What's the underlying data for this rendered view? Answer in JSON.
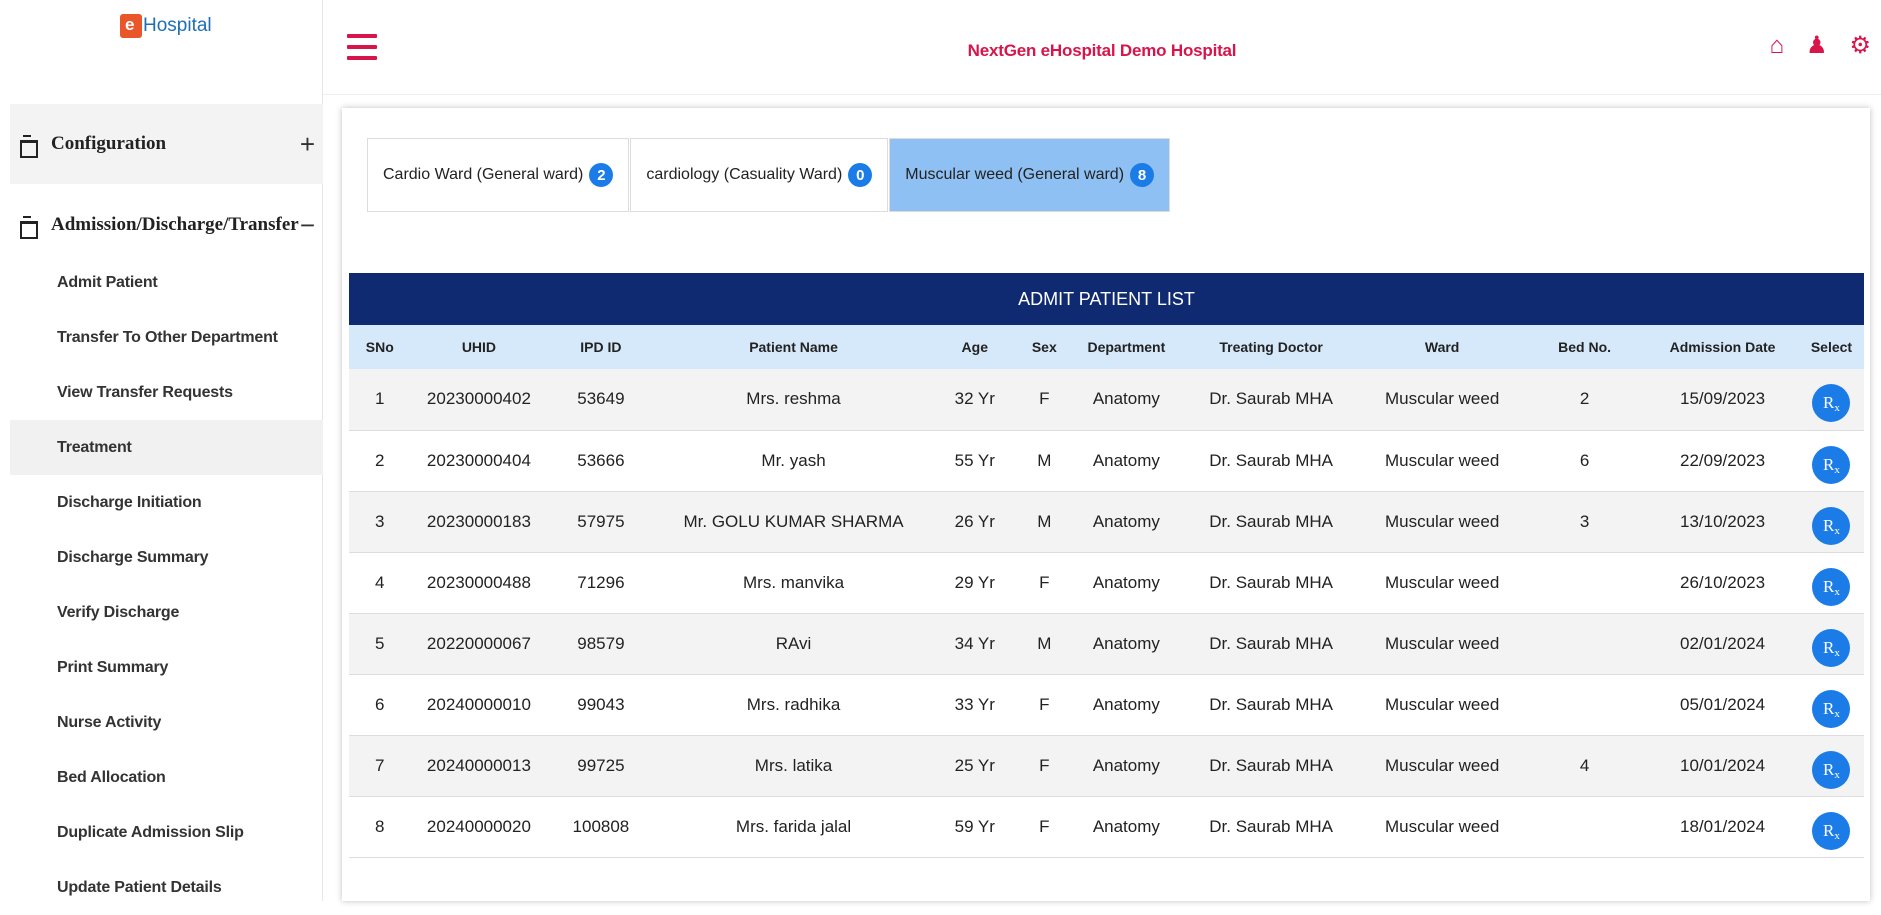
{
  "app": {
    "logo_text": "Hospital",
    "hospital_name": "NextGen eHospital Demo Hospital"
  },
  "sidebar": {
    "configuration": {
      "label": "Configuration",
      "toggle": "+"
    },
    "adt": {
      "label": "Admission/Discharge/Transfer",
      "toggle": "−"
    },
    "items": [
      {
        "label": "Admit Patient"
      },
      {
        "label": "Transfer To Other Department"
      },
      {
        "label": "View Transfer Requests"
      },
      {
        "label": "Treatment"
      },
      {
        "label": "Discharge Initiation"
      },
      {
        "label": "Discharge Summary"
      },
      {
        "label": "Verify Discharge"
      },
      {
        "label": "Print Summary"
      },
      {
        "label": "Nurse Activity"
      },
      {
        "label": "Bed Allocation"
      },
      {
        "label": "Duplicate Admission Slip"
      },
      {
        "label": "Update Patient Details"
      }
    ],
    "active_item": "Treatment"
  },
  "top_icons": [
    "home-icon",
    "user-icon",
    "gear-icon"
  ],
  "tabs": [
    {
      "label": "Cardio Ward (General ward)",
      "count": "2",
      "active": false
    },
    {
      "label": "cardiology (Casuality Ward)",
      "count": "0",
      "active": false
    },
    {
      "label": "Muscular weed (General ward)",
      "count": "8",
      "active": true
    }
  ],
  "list": {
    "title": "ADMIT PATIENT LIST",
    "headers": [
      "SNo",
      "UHID",
      "IPD ID",
      "Patient Name",
      "Age",
      "Sex",
      "Department",
      "Treating Doctor",
      "Ward",
      "Bed No.",
      "Admission Date",
      "Select"
    ],
    "rows": [
      [
        "1",
        "20230000402",
        "53649",
        "Mrs. reshma",
        "32 Yr",
        "F",
        "Anatomy",
        "Dr. Saurab MHA",
        "Muscular weed",
        "2",
        "15/09/2023"
      ],
      [
        "2",
        "20230000404",
        "53666",
        "Mr. yash",
        "55 Yr",
        "M",
        "Anatomy",
        "Dr. Saurab MHA",
        "Muscular weed",
        "6",
        "22/09/2023"
      ],
      [
        "3",
        "20230000183",
        "57975",
        "Mr. GOLU KUMAR SHARMA",
        "26 Yr",
        "M",
        "Anatomy",
        "Dr. Saurab MHA",
        "Muscular weed",
        "3",
        "13/10/2023"
      ],
      [
        "4",
        "20230000488",
        "71296",
        "Mrs. manvika",
        "29 Yr",
        "F",
        "Anatomy",
        "Dr. Saurab MHA",
        "Muscular weed",
        "",
        "26/10/2023"
      ],
      [
        "5",
        "20220000067",
        "98579",
        "RAvi",
        "34 Yr",
        "M",
        "Anatomy",
        "Dr. Saurab MHA",
        "Muscular weed",
        "",
        "02/01/2024"
      ],
      [
        "6",
        "20240000010",
        "99043",
        "Mrs. radhika",
        "33 Yr",
        "F",
        "Anatomy",
        "Dr. Saurab MHA",
        "Muscular weed",
        "",
        "05/01/2024"
      ],
      [
        "7",
        "20240000013",
        "99725",
        "Mrs. latika",
        "25 Yr",
        "F",
        "Anatomy",
        "Dr. Saurab MHA",
        "Muscular weed",
        "4",
        "10/01/2024"
      ],
      [
        "8",
        "20240000020",
        "100808",
        "Mrs. farida jalal",
        "59 Yr",
        "F",
        "Anatomy",
        "Dr. Saurab MHA",
        "Muscular weed",
        "",
        "18/01/2024"
      ]
    ],
    "select_label": "R",
    "select_sub": "x"
  },
  "colors": {
    "accent": "#d8154a",
    "header": "#0f2a70",
    "badge": "#1b7ce8",
    "active_tab": "#8fc0f3"
  }
}
